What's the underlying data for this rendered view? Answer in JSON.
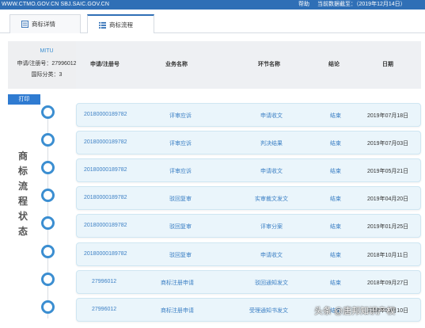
{
  "topbar": {
    "url": "WWW.CTMO.GOV.CN SBJ.SAIC.GOV.CN",
    "help": "帮助",
    "data_as_of": "当前数据截至：（2019年12月14日）"
  },
  "tabs": [
    {
      "label": "商标详情",
      "icon": "document-icon"
    },
    {
      "label": "商标流程",
      "icon": "list-icon"
    }
  ],
  "trademark": {
    "name": "MITU",
    "reg_number": "申请/注册号：27996012",
    "intl_class": "国际分类：3"
  },
  "table": {
    "headers": [
      "申请/注册号",
      "业务名称",
      "环节名称",
      "结论",
      "日期"
    ]
  },
  "print_button": "打印",
  "vertical_title": [
    "商",
    "标",
    "流",
    "程",
    "状",
    "态"
  ],
  "rows": [
    {
      "reg": "20180000189782",
      "business": "评审应诉",
      "step": "申请收文",
      "result": "结束",
      "date": "2019年07月18日"
    },
    {
      "reg": "20180000189782",
      "business": "评审应诉",
      "step": "判决结果",
      "result": "结束",
      "date": "2019年07月03日"
    },
    {
      "reg": "20180000189782",
      "business": "评审应诉",
      "step": "申请收文",
      "result": "结束",
      "date": "2019年05月21日"
    },
    {
      "reg": "20180000189782",
      "business": "驳回复审",
      "step": "实审裁文发文",
      "result": "结束",
      "date": "2019年04月20日"
    },
    {
      "reg": "20180000189782",
      "business": "驳回复审",
      "step": "评审分案",
      "result": "结束",
      "date": "2019年01月25日"
    },
    {
      "reg": "20180000189782",
      "business": "驳回复审",
      "step": "申请收文",
      "result": "结束",
      "date": "2018年10月11日"
    },
    {
      "reg": "27996012",
      "business": "商标注册申请",
      "step": "驳回通知发文",
      "result": "结束",
      "date": "2018年09月27日"
    },
    {
      "reg": "27996012",
      "business": "商标注册申请",
      "step": "受理通知书发文",
      "result": "结束",
      "date": "2018年09月10日"
    }
  ],
  "watermark": "头条 @唐邦知识产权"
}
